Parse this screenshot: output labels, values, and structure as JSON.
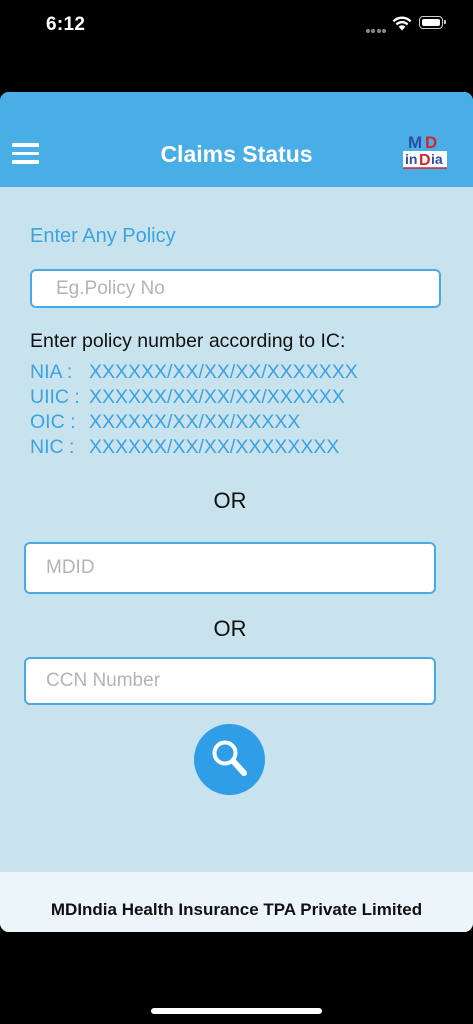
{
  "status_bar": {
    "time": "6:12",
    "icons": [
      "cellular-dots-icon",
      "wifi-icon",
      "battery-icon"
    ]
  },
  "header": {
    "title": "Claims Status",
    "menu_icon": "hamburger-menu-icon",
    "logo": {
      "top_text": "MD",
      "bottom_text": "inDia",
      "color_blue": "#2d4fa3",
      "color_red": "#d2252d"
    },
    "background_color": "#4aaee6"
  },
  "form": {
    "policy_label": "Enter Any Policy",
    "policy_placeholder": "Eg.Policy No",
    "policy_value": "",
    "hint_title": "Enter policy number according to IC:",
    "ic_formats": [
      {
        "code": "NIA :",
        "pattern": "XXXXXX/XX/XX/XX/XXXXXXX"
      },
      {
        "code": "UIIC :",
        "pattern": "XXXXXX/XX/XX/XX/XXXXXX"
      },
      {
        "code": "OIC :",
        "pattern": "XXXXXX/XX/XX/XXXXX"
      },
      {
        "code": "NIC :",
        "pattern": "XXXXXX/XX/XX/XXXXXXXX"
      }
    ],
    "or_label_1": "OR",
    "mdid_placeholder": "MDID",
    "mdid_value": "",
    "or_label_2": "OR",
    "ccn_placeholder": "CCN Number",
    "ccn_value": "",
    "search_icon": "magnifier-search-icon"
  },
  "footer": {
    "text": "MDIndia Health Insurance TPA Private Limited"
  },
  "colors": {
    "accent_blue": "#3aa3e0",
    "page_background": "#c9e3ee",
    "footer_background": "#ecf5fa",
    "search_button": "#2f9ee6"
  }
}
